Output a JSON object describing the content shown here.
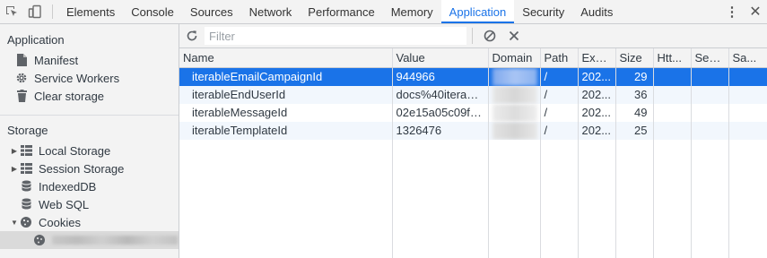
{
  "tabs": [
    {
      "label": "Elements"
    },
    {
      "label": "Console"
    },
    {
      "label": "Sources"
    },
    {
      "label": "Network"
    },
    {
      "label": "Performance"
    },
    {
      "label": "Memory"
    },
    {
      "label": "Application",
      "active": true
    },
    {
      "label": "Security"
    },
    {
      "label": "Audits"
    }
  ],
  "sidebar": {
    "application_title": "Application",
    "application_items": [
      {
        "label": "Manifest",
        "icon": "file-icon"
      },
      {
        "label": "Service Workers",
        "icon": "gear-icon"
      },
      {
        "label": "Clear storage",
        "icon": "trash-icon"
      }
    ],
    "storage_title": "Storage",
    "storage_items": [
      {
        "label": "Local Storage",
        "icon": "grid-icon",
        "expandable": true
      },
      {
        "label": "Session Storage",
        "icon": "grid-icon",
        "expandable": true
      },
      {
        "label": "IndexedDB",
        "icon": "database-icon"
      },
      {
        "label": "Web SQL",
        "icon": "database-icon"
      },
      {
        "label": "Cookies",
        "icon": "cookie-icon",
        "expanded": true
      }
    ]
  },
  "toolbar": {
    "filter_placeholder": "Filter"
  },
  "table": {
    "columns": [
      "Name",
      "Value",
      "Domain",
      "Path",
      "Exp...",
      "Size",
      "Htt...",
      "Sec...",
      "Sa..."
    ],
    "rows": [
      {
        "name": "iterableEmailCampaignId",
        "value": "944966",
        "path": "/",
        "expires": "202...",
        "size": "29",
        "selected": true
      },
      {
        "name": "iterableEndUserId",
        "value": "docs%40iterabl...",
        "path": "/",
        "expires": "202...",
        "size": "36"
      },
      {
        "name": "iterableMessageId",
        "value": "02e15a05c09f4...",
        "path": "/",
        "expires": "202...",
        "size": "49"
      },
      {
        "name": "iterableTemplateId",
        "value": "1326476",
        "path": "/",
        "expires": "202...",
        "size": "25"
      }
    ]
  },
  "colors": {
    "accent": "#1a73e8",
    "selected_row": "#1a73e8",
    "alt_row": "#f2f7fd"
  }
}
